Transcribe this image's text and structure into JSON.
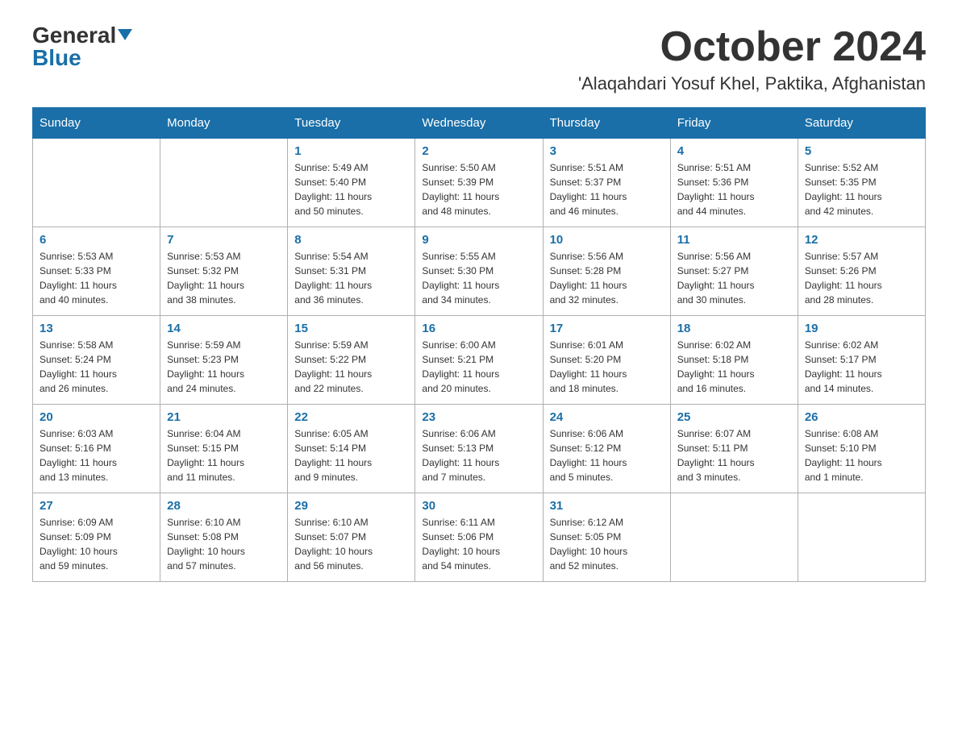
{
  "header": {
    "logo_general": "General",
    "logo_blue": "Blue",
    "month_title": "October 2024",
    "location": "'Alaqahdari Yosuf Khel, Paktika, Afghanistan"
  },
  "weekdays": [
    "Sunday",
    "Monday",
    "Tuesday",
    "Wednesday",
    "Thursday",
    "Friday",
    "Saturday"
  ],
  "weeks": [
    [
      {
        "day": "",
        "info": ""
      },
      {
        "day": "",
        "info": ""
      },
      {
        "day": "1",
        "info": "Sunrise: 5:49 AM\nSunset: 5:40 PM\nDaylight: 11 hours\nand 50 minutes."
      },
      {
        "day": "2",
        "info": "Sunrise: 5:50 AM\nSunset: 5:39 PM\nDaylight: 11 hours\nand 48 minutes."
      },
      {
        "day": "3",
        "info": "Sunrise: 5:51 AM\nSunset: 5:37 PM\nDaylight: 11 hours\nand 46 minutes."
      },
      {
        "day": "4",
        "info": "Sunrise: 5:51 AM\nSunset: 5:36 PM\nDaylight: 11 hours\nand 44 minutes."
      },
      {
        "day": "5",
        "info": "Sunrise: 5:52 AM\nSunset: 5:35 PM\nDaylight: 11 hours\nand 42 minutes."
      }
    ],
    [
      {
        "day": "6",
        "info": "Sunrise: 5:53 AM\nSunset: 5:33 PM\nDaylight: 11 hours\nand 40 minutes."
      },
      {
        "day": "7",
        "info": "Sunrise: 5:53 AM\nSunset: 5:32 PM\nDaylight: 11 hours\nand 38 minutes."
      },
      {
        "day": "8",
        "info": "Sunrise: 5:54 AM\nSunset: 5:31 PM\nDaylight: 11 hours\nand 36 minutes."
      },
      {
        "day": "9",
        "info": "Sunrise: 5:55 AM\nSunset: 5:30 PM\nDaylight: 11 hours\nand 34 minutes."
      },
      {
        "day": "10",
        "info": "Sunrise: 5:56 AM\nSunset: 5:28 PM\nDaylight: 11 hours\nand 32 minutes."
      },
      {
        "day": "11",
        "info": "Sunrise: 5:56 AM\nSunset: 5:27 PM\nDaylight: 11 hours\nand 30 minutes."
      },
      {
        "day": "12",
        "info": "Sunrise: 5:57 AM\nSunset: 5:26 PM\nDaylight: 11 hours\nand 28 minutes."
      }
    ],
    [
      {
        "day": "13",
        "info": "Sunrise: 5:58 AM\nSunset: 5:24 PM\nDaylight: 11 hours\nand 26 minutes."
      },
      {
        "day": "14",
        "info": "Sunrise: 5:59 AM\nSunset: 5:23 PM\nDaylight: 11 hours\nand 24 minutes."
      },
      {
        "day": "15",
        "info": "Sunrise: 5:59 AM\nSunset: 5:22 PM\nDaylight: 11 hours\nand 22 minutes."
      },
      {
        "day": "16",
        "info": "Sunrise: 6:00 AM\nSunset: 5:21 PM\nDaylight: 11 hours\nand 20 minutes."
      },
      {
        "day": "17",
        "info": "Sunrise: 6:01 AM\nSunset: 5:20 PM\nDaylight: 11 hours\nand 18 minutes."
      },
      {
        "day": "18",
        "info": "Sunrise: 6:02 AM\nSunset: 5:18 PM\nDaylight: 11 hours\nand 16 minutes."
      },
      {
        "day": "19",
        "info": "Sunrise: 6:02 AM\nSunset: 5:17 PM\nDaylight: 11 hours\nand 14 minutes."
      }
    ],
    [
      {
        "day": "20",
        "info": "Sunrise: 6:03 AM\nSunset: 5:16 PM\nDaylight: 11 hours\nand 13 minutes."
      },
      {
        "day": "21",
        "info": "Sunrise: 6:04 AM\nSunset: 5:15 PM\nDaylight: 11 hours\nand 11 minutes."
      },
      {
        "day": "22",
        "info": "Sunrise: 6:05 AM\nSunset: 5:14 PM\nDaylight: 11 hours\nand 9 minutes."
      },
      {
        "day": "23",
        "info": "Sunrise: 6:06 AM\nSunset: 5:13 PM\nDaylight: 11 hours\nand 7 minutes."
      },
      {
        "day": "24",
        "info": "Sunrise: 6:06 AM\nSunset: 5:12 PM\nDaylight: 11 hours\nand 5 minutes."
      },
      {
        "day": "25",
        "info": "Sunrise: 6:07 AM\nSunset: 5:11 PM\nDaylight: 11 hours\nand 3 minutes."
      },
      {
        "day": "26",
        "info": "Sunrise: 6:08 AM\nSunset: 5:10 PM\nDaylight: 11 hours\nand 1 minute."
      }
    ],
    [
      {
        "day": "27",
        "info": "Sunrise: 6:09 AM\nSunset: 5:09 PM\nDaylight: 10 hours\nand 59 minutes."
      },
      {
        "day": "28",
        "info": "Sunrise: 6:10 AM\nSunset: 5:08 PM\nDaylight: 10 hours\nand 57 minutes."
      },
      {
        "day": "29",
        "info": "Sunrise: 6:10 AM\nSunset: 5:07 PM\nDaylight: 10 hours\nand 56 minutes."
      },
      {
        "day": "30",
        "info": "Sunrise: 6:11 AM\nSunset: 5:06 PM\nDaylight: 10 hours\nand 54 minutes."
      },
      {
        "day": "31",
        "info": "Sunrise: 6:12 AM\nSunset: 5:05 PM\nDaylight: 10 hours\nand 52 minutes."
      },
      {
        "day": "",
        "info": ""
      },
      {
        "day": "",
        "info": ""
      }
    ]
  ]
}
